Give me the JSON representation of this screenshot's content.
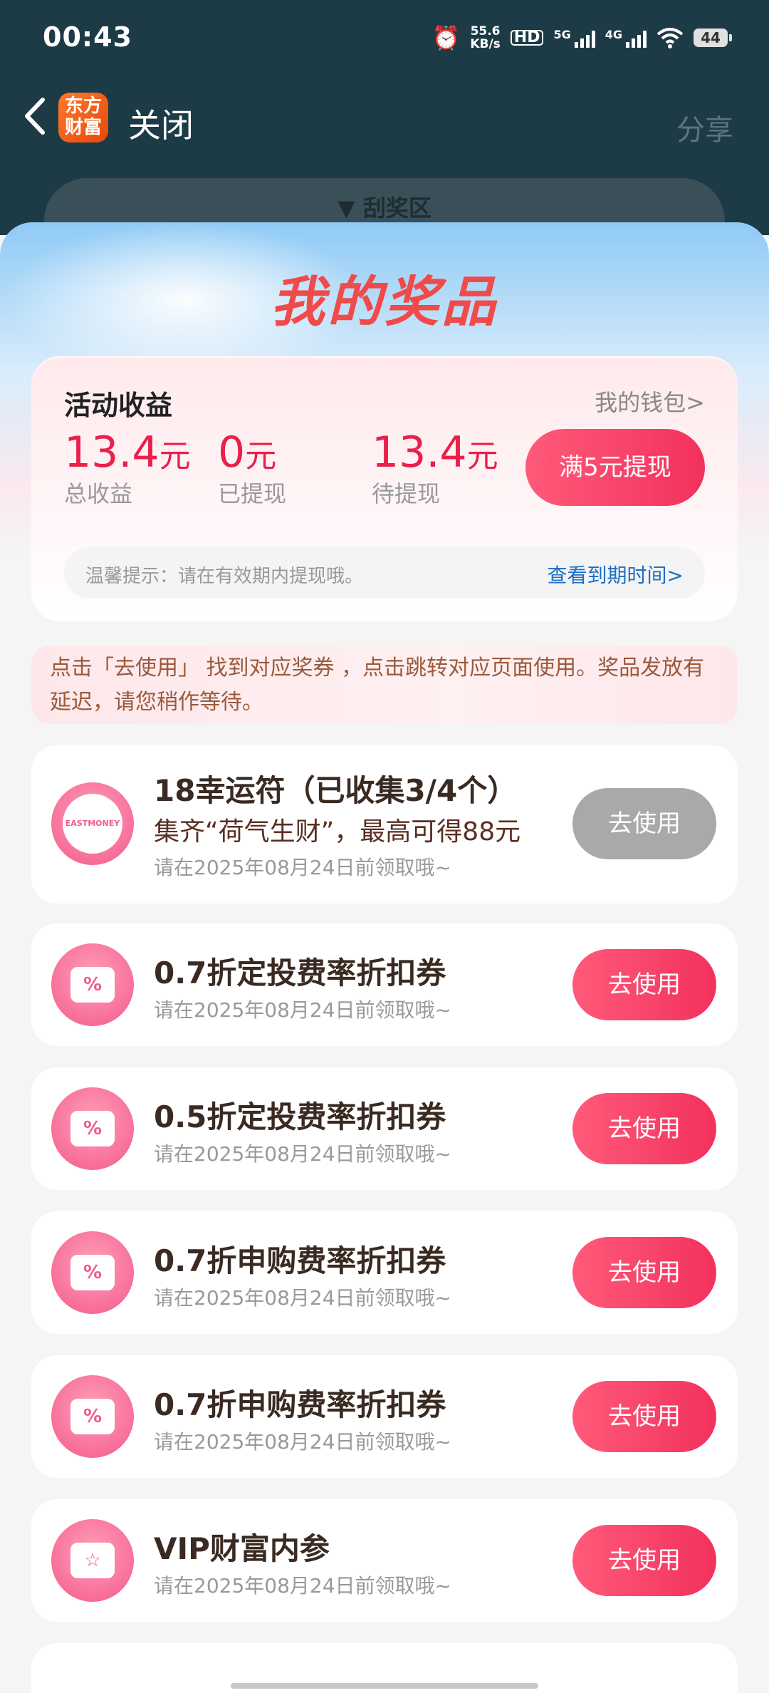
{
  "status_bar": {
    "time": "00:43",
    "net_speed_value": "55.6",
    "net_speed_unit": "KB/s",
    "hd_label": "HD",
    "sim1_label": "5G",
    "sim2_label": "4G",
    "battery": "44"
  },
  "nav": {
    "logo_text_line1": "东方",
    "logo_text_line2": "财富",
    "close_label": "关闭",
    "share_label": "分享"
  },
  "scratch_tab": {
    "label": "▼ 刮奖区"
  },
  "sheet": {
    "title": "我的奖品"
  },
  "earnings": {
    "title": "活动收益",
    "wallet_link": "我的钱包>",
    "total": {
      "value": "13.4",
      "unit": "元",
      "label": "总收益"
    },
    "withdrawn": {
      "value": "0",
      "unit": "元",
      "label": "已提现"
    },
    "pending": {
      "value": "13.4",
      "unit": "元",
      "label": "待提现"
    },
    "withdraw_button": "满5元提现",
    "tip_text": "温馨提示：请在有效期内提现哦。",
    "tip_link": "查看到期时间>"
  },
  "notice": "点击「去使用」 找到对应奖券 ，点击跳转对应页面使用。奖品发放有延迟，请您稍作等待。",
  "prizes": [
    {
      "title": "18幸运符（已收集3/4个）",
      "subtitle": "集齐“荷气生财”，最高可得88元",
      "expiry": "请在2025年08月24日前领取哦~",
      "button": "去使用",
      "icon": "eastmoney-badge-icon",
      "icon_text": "EASTMONEY",
      "enabled": false
    },
    {
      "title": "0.7折定投费率折扣券",
      "expiry": "请在2025年08月24日前领取哦~",
      "button": "去使用",
      "icon": "coupon-percent-icon",
      "icon_text": "%",
      "enabled": true
    },
    {
      "title": "0.5折定投费率折扣券",
      "expiry": "请在2025年08月24日前领取哦~",
      "button": "去使用",
      "icon": "coupon-percent-icon",
      "icon_text": "%",
      "enabled": true
    },
    {
      "title": "0.7折申购费率折扣券",
      "expiry": "请在2025年08月24日前领取哦~",
      "button": "去使用",
      "icon": "coupon-percent-icon",
      "icon_text": "%",
      "enabled": true
    },
    {
      "title": "0.7折申购费率折扣券",
      "expiry": "请在2025年08月24日前领取哦~",
      "button": "去使用",
      "icon": "coupon-percent-icon",
      "icon_text": "%",
      "enabled": true
    },
    {
      "title": "VIP财富内参",
      "expiry": "请在2025年08月24日前领取哦~",
      "button": "去使用",
      "icon": "coupon-star-icon",
      "icon_text": "☆",
      "enabled": true
    }
  ],
  "colors": {
    "header_bg": "#1c3b47",
    "accent": "#f2315d",
    "amount": "#e8204a",
    "link": "#1d6fc2",
    "disabled_button": "#a9a9a9"
  }
}
